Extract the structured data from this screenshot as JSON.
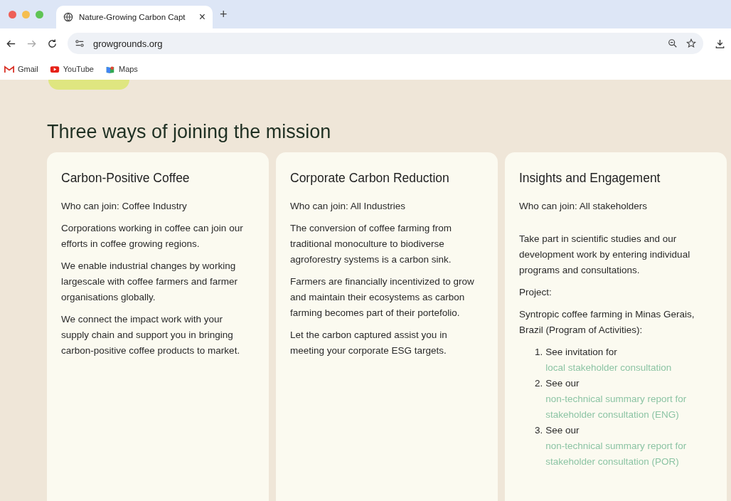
{
  "browser": {
    "tab_title": "Nature-Growing Carbon Capt",
    "new_tab": "+",
    "close": "×",
    "url": "growgrounds.org",
    "bookmarks": [
      "Gmail",
      "YouTube",
      "Maps"
    ]
  },
  "heading": "Three ways of joining the mission",
  "cards": [
    {
      "title": "Carbon-Positive Coffee",
      "who": "Who can join: Coffee Industry",
      "paragraphs": [
        "Corporations working in coffee can join our efforts in coffee growing regions.",
        "We enable industrial changes by working largescale with coffee farmers and farmer organisations globally.",
        "We connect the impact work with your supply chain and support you in bringing carbon-positive coffee products to market."
      ]
    },
    {
      "title": "Corporate Carbon Reduction",
      "who": "Who can join: All Industries",
      "paragraphs": [
        "The conversion of coffee farming from traditional monoculture to biodiverse agroforestry systems is a carbon sink.",
        "Farmers are financially incentivized to grow and maintain their ecosystems as carbon farming becomes part of their portefolio.",
        "Let the carbon captured assist you in meeting your corporate ESG targets."
      ]
    },
    {
      "title": "Insights and Engagement",
      "who": "Who can join: All stakeholders",
      "paragraphs": [
        "Take part in scientific studies and our development work by entering individual programs and consultations.",
        "Project:",
        "Syntropic coffee farming in Minas Gerais, Brazil (Program of Activities):"
      ],
      "list": [
        {
          "number": "1.",
          "text": "See invitation for",
          "link": "local stakeholder consultation"
        },
        {
          "number": "2.",
          "text": "See our",
          "link": "non-technical summary report for stakeholder consultation (ENG)"
        },
        {
          "number": "3.",
          "text": "See our",
          "link": "non-technical summary report for stakeholder consultation (POR)"
        }
      ]
    }
  ]
}
